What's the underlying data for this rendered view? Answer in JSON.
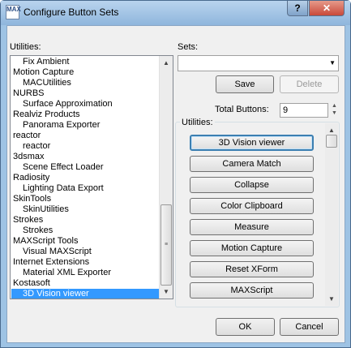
{
  "window": {
    "title": "Configure Button Sets",
    "icon_text": "MAX",
    "help_label": "?",
    "close_label": "✕"
  },
  "left": {
    "label": "Utilities:",
    "items": [
      {
        "label": "Fix Ambient",
        "level": "child"
      },
      {
        "label": "Motion Capture",
        "level": "parent"
      },
      {
        "label": "MACUtilities",
        "level": "child"
      },
      {
        "label": "NURBS",
        "level": "parent"
      },
      {
        "label": "Surface Approximation",
        "level": "child"
      },
      {
        "label": "Realviz Products",
        "level": "parent"
      },
      {
        "label": "Panorama Exporter",
        "level": "child"
      },
      {
        "label": "reactor",
        "level": "parent"
      },
      {
        "label": "reactor",
        "level": "child"
      },
      {
        "label": "3dsmax",
        "level": "parent"
      },
      {
        "label": "Scene Effect Loader",
        "level": "child"
      },
      {
        "label": "Radiosity",
        "level": "parent"
      },
      {
        "label": "Lighting Data Export",
        "level": "child"
      },
      {
        "label": "SkinTools",
        "level": "parent"
      },
      {
        "label": "SkinUtilities",
        "level": "child"
      },
      {
        "label": "Strokes",
        "level": "parent"
      },
      {
        "label": "Strokes",
        "level": "child"
      },
      {
        "label": "MAXScript Tools",
        "level": "parent"
      },
      {
        "label": "Visual MAXScript",
        "level": "child"
      },
      {
        "label": "Internet Extensions",
        "level": "parent"
      },
      {
        "label": "Material XML Exporter",
        "level": "child"
      },
      {
        "label": "Kostasoft",
        "level": "parent"
      },
      {
        "label": "3D Vision viewer",
        "level": "child",
        "selected": true
      }
    ]
  },
  "sets": {
    "label": "Sets:",
    "combo_value": "",
    "save_label": "Save",
    "delete_label": "Delete",
    "total_label": "Total Buttons:",
    "total_value": "9"
  },
  "utilities": {
    "label": "Utilities:",
    "buttons": [
      "3D Vision viewer",
      "Camera Match",
      "Collapse",
      "Color Clipboard",
      "Measure",
      "Motion Capture",
      "Reset XForm",
      "MAXScript"
    ]
  },
  "footer": {
    "ok_label": "OK",
    "cancel_label": "Cancel"
  }
}
